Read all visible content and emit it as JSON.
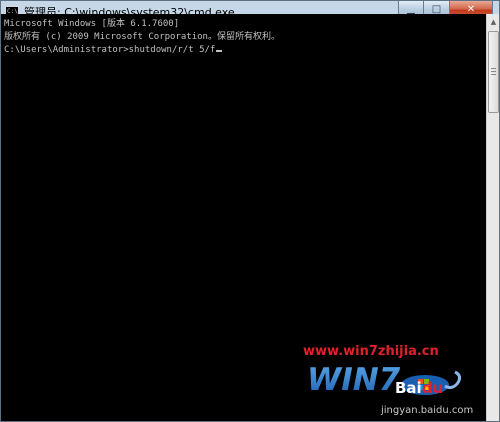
{
  "window": {
    "title": "管理员: C:\\windows\\system32\\cmd.exe",
    "app_icon_text": "C:\\",
    "minimize_glyph": "▁",
    "maximize_glyph": "□",
    "close_glyph": "✕"
  },
  "console": {
    "lines": [
      "Microsoft Windows [版本 6.1.7600]",
      "版权所有 (c) 2009 Microsoft Corporation。保留所有权利。",
      "",
      "C:\\Users\\Administrator>shutdown/r/t 5/f"
    ]
  },
  "scrollbar": {
    "up_glyph": "▲"
  },
  "watermarks": {
    "site_url": "www.win7zhijia.cn",
    "logo_text": "WIN7",
    "baidu_text": "Bai",
    "baidu_du": "du",
    "jingyan_text": "jingyan.baidu.com"
  },
  "colors": {
    "console_bg": "#000000",
    "console_text": "#c0c0c0",
    "watermark_red": "#e0202a"
  }
}
